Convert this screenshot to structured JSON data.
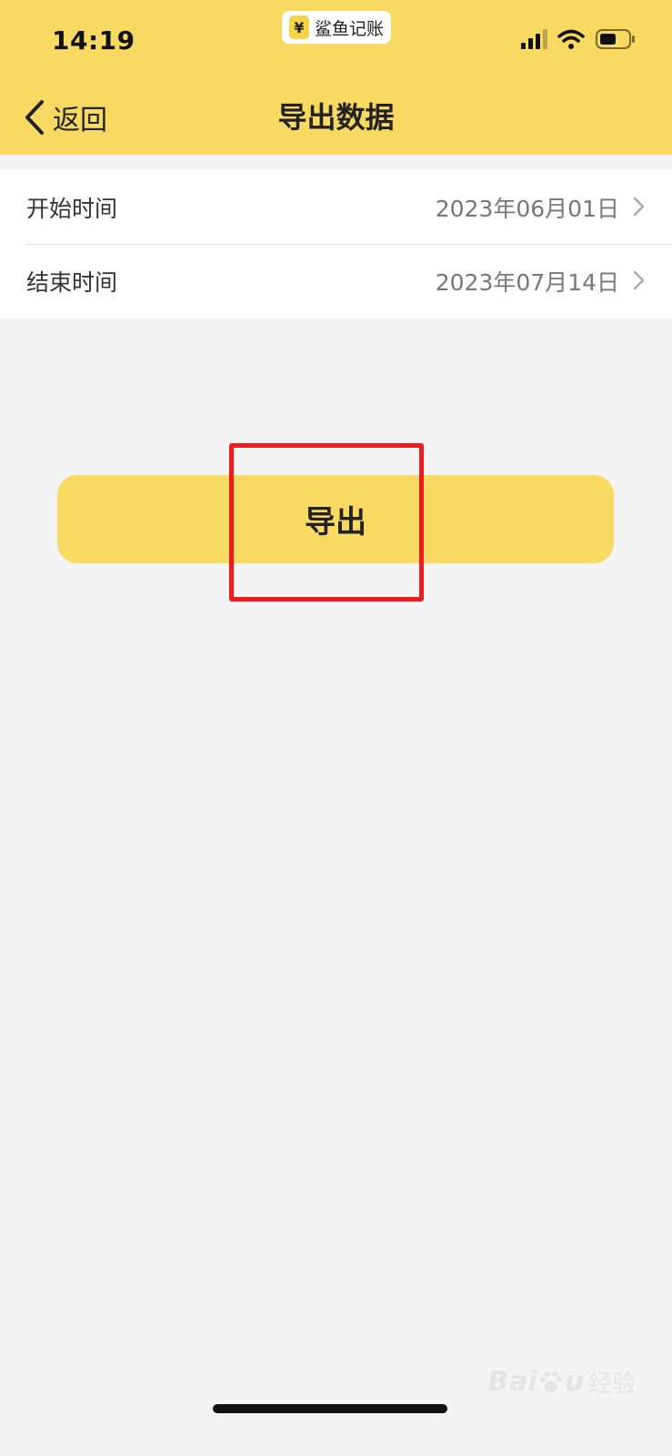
{
  "status_bar": {
    "time": "14:19",
    "app_name": "鲨鱼记账",
    "app_logo_glyph": "¥",
    "signal_icon": "signal-icon",
    "wifi_icon": "wifi-icon",
    "battery_icon": "battery-icon"
  },
  "nav": {
    "back_label": "返回",
    "title": "导出数据"
  },
  "date_range": [
    {
      "label": "开始时间",
      "value": "2023年06月01日"
    },
    {
      "label": "结束时间",
      "value": "2023年07月14日"
    }
  ],
  "actions": {
    "export_label": "导出"
  },
  "watermark": {
    "brand": "Bai",
    "brand_suffix": "u",
    "sub": "经验"
  },
  "colors": {
    "accent": "#f8da62",
    "highlight": "#ee1c1c",
    "background": "#f4f4f4"
  }
}
